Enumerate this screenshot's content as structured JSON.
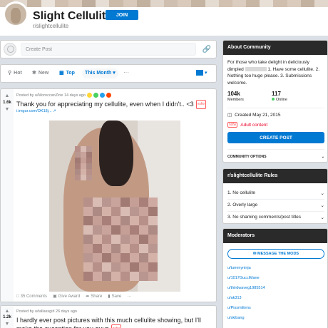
{
  "header": {
    "title": "Slight Cellulite",
    "sub_name": "r/slightcellulite",
    "join_label": "JOIN"
  },
  "banner_colors": [
    "#d5c6b8",
    "#e2d8ce",
    "#c7b5a3",
    "#ebe4dd",
    "#d1c0b0",
    "#dcccbe",
    "#bfae9d",
    "#e6ddd4",
    "#cdbba9",
    "#d8c9bb",
    "#c3b19f",
    "#e0d5ca",
    "#cfbfb0",
    "#d9cabc",
    "#c6b4a2",
    "#e4dbd1",
    "#d2c1b1",
    "#dbcdbf",
    "#c8b6a4",
    "#e8e0d7",
    "#d0bfae",
    "#dacbbd",
    "#c4b2a0",
    "#e1d7cc"
  ],
  "create_post": {
    "placeholder": "Create Post",
    "avatar_icon": "user-avatar-icon",
    "link_icon": "link-icon"
  },
  "sort": {
    "hot": "Hot",
    "new": "New",
    "top": "Top",
    "period": "This Month",
    "more": "···"
  },
  "posts": [
    {
      "score": "1.6k",
      "posted_by": "Posted by u/MoroccanZine 14 days ago",
      "title": "Thank you for appreciating my cellulite, even when I didn't.. <3",
      "tag": "nsfw",
      "link": "i.imgur.com/OK18j...",
      "comments": "35 Comments",
      "award": "Give Award",
      "share": "Share",
      "save": "Save",
      "more": "···"
    },
    {
      "score": "1.2k",
      "posted_by": "Posted by u/tallassgirl 26 days ago",
      "title": "I hardly ever post pictures with this much cellulite showing, but I'll make the exception for you guys",
      "tag": "nsfw"
    }
  ],
  "about": {
    "heading": "About Community",
    "desc_before": "For those who take delight in deliciously dimpled",
    "desc_after": "1. Have some cellulite. 2. Nothing too huge please. 3. Submissions welcome.",
    "members_count": "104k",
    "members_label": "Members",
    "online_count": "117",
    "online_label": "Online",
    "created": "Created May 21, 2015",
    "adult_tag": "nsfw",
    "adult_label": "Adult content",
    "create_post_label": "CREATE POST",
    "community_options": "COMMUNITY OPTIONS"
  },
  "rules": {
    "heading": "r/slightcellulite Rules",
    "items": [
      "1. No cellulite",
      "2. Overly large",
      "3. No shaming comments/post titles"
    ]
  },
  "moderators": {
    "heading": "Moderators",
    "message_label": "MESSAGE THE MODS",
    "items": [
      "u/tummyninja",
      "u/1017GucciMane",
      "u/thirdwaveg1985514",
      "u/ak313",
      "u/Pissmittens",
      "u/skibang"
    ]
  },
  "colors": {
    "accent": "#0079d3",
    "nsfw": "#ff585b",
    "header_bar": "#2a2a2a"
  }
}
